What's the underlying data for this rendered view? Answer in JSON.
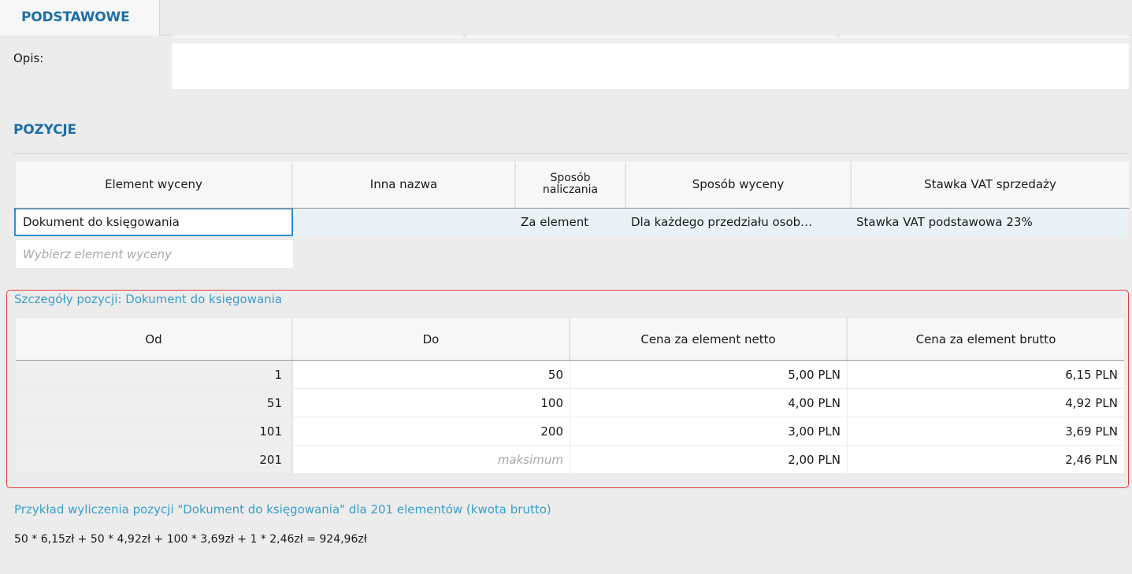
{
  "tab": {
    "label": "PODSTAWOWE"
  },
  "opis": {
    "label": "Opis:",
    "value": ""
  },
  "pozycje": {
    "title": "POZYCJE",
    "headers": [
      "Element wyceny",
      "Inna nazwa",
      "Sposób naliczania",
      "Sposób wyceny",
      "Stawka VAT sprzedaży"
    ],
    "header_split": {
      "line1": "Sposób",
      "line2": "naliczania"
    },
    "row": {
      "element": "Dokument do księgowania",
      "inna_nazwa": "",
      "sposob_naliczania": "Za element",
      "sposob_wyceny": "Dla każdego przedziału osob…",
      "stawka_vat": "Stawka VAT podstawowa 23%"
    },
    "placeholder": "Wybierz element wyceny"
  },
  "details": {
    "title": "Szczegóły pozycji: Dokument do księgowania",
    "headers": [
      "Od",
      "Do",
      "Cena za element netto",
      "Cena za element brutto"
    ],
    "rows": [
      {
        "od": "1",
        "do": "50",
        "netto": "5,00 PLN",
        "brutto": "6,15 PLN"
      },
      {
        "od": "51",
        "do": "100",
        "netto": "4,00 PLN",
        "brutto": "4,92 PLN"
      },
      {
        "od": "101",
        "do": "200",
        "netto": "3,00 PLN",
        "brutto": "3,69 PLN"
      },
      {
        "od": "201",
        "do": "maksimum",
        "netto": "2,00 PLN",
        "brutto": "2,46 PLN"
      }
    ]
  },
  "example": {
    "title": "Przykład wyliczenia pozycji \"Dokument do księgowania\" dla 201 elementów (kwota brutto)",
    "formula": "50 * 6,15zł + 50 * 4,92zł + 100 * 3,69zł + 1 * 2,46zł = 924,96zł"
  },
  "colors": {
    "accent": "#1f6fa6",
    "link": "#3a9ec9",
    "highlight_frame": "#e03c3c",
    "selection": "#2f8fd1"
  }
}
